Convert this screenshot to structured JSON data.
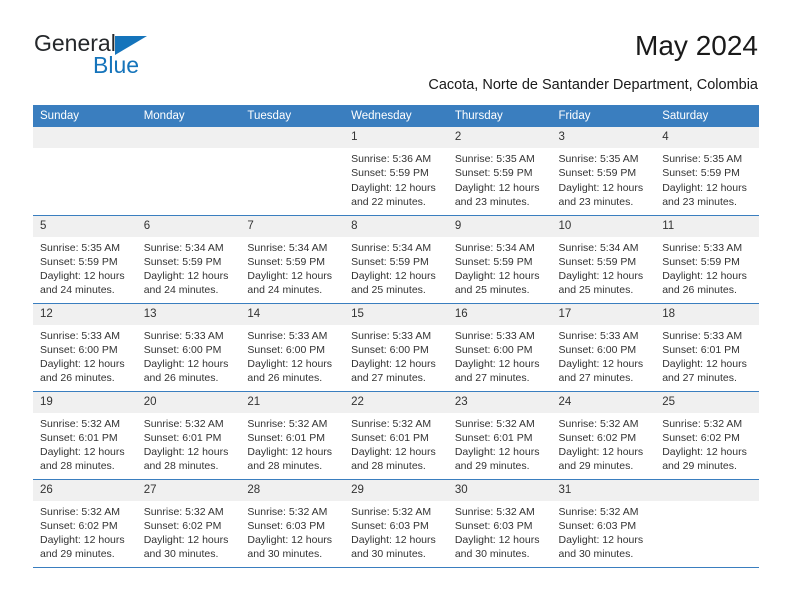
{
  "brand": {
    "name_part1": "General",
    "name_part2": "Blue",
    "logo_icon": "triangle-logo-icon",
    "accent_color": "#1574bb"
  },
  "header": {
    "title": "May 2024",
    "subtitle": "Cacota, Norte de Santander Department, Colombia"
  },
  "theme": {
    "header_row_color": "#3a7ebf",
    "day_number_band_color": "#f0f0f0",
    "text_color": "#333333"
  },
  "weekday_headers": [
    "Sunday",
    "Monday",
    "Tuesday",
    "Wednesday",
    "Thursday",
    "Friday",
    "Saturday"
  ],
  "weeks": [
    [
      {
        "day": "",
        "empty": true,
        "sunrise": "",
        "sunset": "",
        "daylight_line1": "",
        "daylight_line2": ""
      },
      {
        "day": "",
        "empty": true,
        "sunrise": "",
        "sunset": "",
        "daylight_line1": "",
        "daylight_line2": ""
      },
      {
        "day": "",
        "empty": true,
        "sunrise": "",
        "sunset": "",
        "daylight_line1": "",
        "daylight_line2": ""
      },
      {
        "day": "1",
        "empty": false,
        "sunrise": "Sunrise: 5:36 AM",
        "sunset": "Sunset: 5:59 PM",
        "daylight_line1": "Daylight: 12 hours",
        "daylight_line2": "and 22 minutes."
      },
      {
        "day": "2",
        "empty": false,
        "sunrise": "Sunrise: 5:35 AM",
        "sunset": "Sunset: 5:59 PM",
        "daylight_line1": "Daylight: 12 hours",
        "daylight_line2": "and 23 minutes."
      },
      {
        "day": "3",
        "empty": false,
        "sunrise": "Sunrise: 5:35 AM",
        "sunset": "Sunset: 5:59 PM",
        "daylight_line1": "Daylight: 12 hours",
        "daylight_line2": "and 23 minutes."
      },
      {
        "day": "4",
        "empty": false,
        "sunrise": "Sunrise: 5:35 AM",
        "sunset": "Sunset: 5:59 PM",
        "daylight_line1": "Daylight: 12 hours",
        "daylight_line2": "and 23 minutes."
      }
    ],
    [
      {
        "day": "5",
        "empty": false,
        "sunrise": "Sunrise: 5:35 AM",
        "sunset": "Sunset: 5:59 PM",
        "daylight_line1": "Daylight: 12 hours",
        "daylight_line2": "and 24 minutes."
      },
      {
        "day": "6",
        "empty": false,
        "sunrise": "Sunrise: 5:34 AM",
        "sunset": "Sunset: 5:59 PM",
        "daylight_line1": "Daylight: 12 hours",
        "daylight_line2": "and 24 minutes."
      },
      {
        "day": "7",
        "empty": false,
        "sunrise": "Sunrise: 5:34 AM",
        "sunset": "Sunset: 5:59 PM",
        "daylight_line1": "Daylight: 12 hours",
        "daylight_line2": "and 24 minutes."
      },
      {
        "day": "8",
        "empty": false,
        "sunrise": "Sunrise: 5:34 AM",
        "sunset": "Sunset: 5:59 PM",
        "daylight_line1": "Daylight: 12 hours",
        "daylight_line2": "and 25 minutes."
      },
      {
        "day": "9",
        "empty": false,
        "sunrise": "Sunrise: 5:34 AM",
        "sunset": "Sunset: 5:59 PM",
        "daylight_line1": "Daylight: 12 hours",
        "daylight_line2": "and 25 minutes."
      },
      {
        "day": "10",
        "empty": false,
        "sunrise": "Sunrise: 5:34 AM",
        "sunset": "Sunset: 5:59 PM",
        "daylight_line1": "Daylight: 12 hours",
        "daylight_line2": "and 25 minutes."
      },
      {
        "day": "11",
        "empty": false,
        "sunrise": "Sunrise: 5:33 AM",
        "sunset": "Sunset: 5:59 PM",
        "daylight_line1": "Daylight: 12 hours",
        "daylight_line2": "and 26 minutes."
      }
    ],
    [
      {
        "day": "12",
        "empty": false,
        "sunrise": "Sunrise: 5:33 AM",
        "sunset": "Sunset: 6:00 PM",
        "daylight_line1": "Daylight: 12 hours",
        "daylight_line2": "and 26 minutes."
      },
      {
        "day": "13",
        "empty": false,
        "sunrise": "Sunrise: 5:33 AM",
        "sunset": "Sunset: 6:00 PM",
        "daylight_line1": "Daylight: 12 hours",
        "daylight_line2": "and 26 minutes."
      },
      {
        "day": "14",
        "empty": false,
        "sunrise": "Sunrise: 5:33 AM",
        "sunset": "Sunset: 6:00 PM",
        "daylight_line1": "Daylight: 12 hours",
        "daylight_line2": "and 26 minutes."
      },
      {
        "day": "15",
        "empty": false,
        "sunrise": "Sunrise: 5:33 AM",
        "sunset": "Sunset: 6:00 PM",
        "daylight_line1": "Daylight: 12 hours",
        "daylight_line2": "and 27 minutes."
      },
      {
        "day": "16",
        "empty": false,
        "sunrise": "Sunrise: 5:33 AM",
        "sunset": "Sunset: 6:00 PM",
        "daylight_line1": "Daylight: 12 hours",
        "daylight_line2": "and 27 minutes."
      },
      {
        "day": "17",
        "empty": false,
        "sunrise": "Sunrise: 5:33 AM",
        "sunset": "Sunset: 6:00 PM",
        "daylight_line1": "Daylight: 12 hours",
        "daylight_line2": "and 27 minutes."
      },
      {
        "day": "18",
        "empty": false,
        "sunrise": "Sunrise: 5:33 AM",
        "sunset": "Sunset: 6:01 PM",
        "daylight_line1": "Daylight: 12 hours",
        "daylight_line2": "and 27 minutes."
      }
    ],
    [
      {
        "day": "19",
        "empty": false,
        "sunrise": "Sunrise: 5:32 AM",
        "sunset": "Sunset: 6:01 PM",
        "daylight_line1": "Daylight: 12 hours",
        "daylight_line2": "and 28 minutes."
      },
      {
        "day": "20",
        "empty": false,
        "sunrise": "Sunrise: 5:32 AM",
        "sunset": "Sunset: 6:01 PM",
        "daylight_line1": "Daylight: 12 hours",
        "daylight_line2": "and 28 minutes."
      },
      {
        "day": "21",
        "empty": false,
        "sunrise": "Sunrise: 5:32 AM",
        "sunset": "Sunset: 6:01 PM",
        "daylight_line1": "Daylight: 12 hours",
        "daylight_line2": "and 28 minutes."
      },
      {
        "day": "22",
        "empty": false,
        "sunrise": "Sunrise: 5:32 AM",
        "sunset": "Sunset: 6:01 PM",
        "daylight_line1": "Daylight: 12 hours",
        "daylight_line2": "and 28 minutes."
      },
      {
        "day": "23",
        "empty": false,
        "sunrise": "Sunrise: 5:32 AM",
        "sunset": "Sunset: 6:01 PM",
        "daylight_line1": "Daylight: 12 hours",
        "daylight_line2": "and 29 minutes."
      },
      {
        "day": "24",
        "empty": false,
        "sunrise": "Sunrise: 5:32 AM",
        "sunset": "Sunset: 6:02 PM",
        "daylight_line1": "Daylight: 12 hours",
        "daylight_line2": "and 29 minutes."
      },
      {
        "day": "25",
        "empty": false,
        "sunrise": "Sunrise: 5:32 AM",
        "sunset": "Sunset: 6:02 PM",
        "daylight_line1": "Daylight: 12 hours",
        "daylight_line2": "and 29 minutes."
      }
    ],
    [
      {
        "day": "26",
        "empty": false,
        "sunrise": "Sunrise: 5:32 AM",
        "sunset": "Sunset: 6:02 PM",
        "daylight_line1": "Daylight: 12 hours",
        "daylight_line2": "and 29 minutes."
      },
      {
        "day": "27",
        "empty": false,
        "sunrise": "Sunrise: 5:32 AM",
        "sunset": "Sunset: 6:02 PM",
        "daylight_line1": "Daylight: 12 hours",
        "daylight_line2": "and 30 minutes."
      },
      {
        "day": "28",
        "empty": false,
        "sunrise": "Sunrise: 5:32 AM",
        "sunset": "Sunset: 6:03 PM",
        "daylight_line1": "Daylight: 12 hours",
        "daylight_line2": "and 30 minutes."
      },
      {
        "day": "29",
        "empty": false,
        "sunrise": "Sunrise: 5:32 AM",
        "sunset": "Sunset: 6:03 PM",
        "daylight_line1": "Daylight: 12 hours",
        "daylight_line2": "and 30 minutes."
      },
      {
        "day": "30",
        "empty": false,
        "sunrise": "Sunrise: 5:32 AM",
        "sunset": "Sunset: 6:03 PM",
        "daylight_line1": "Daylight: 12 hours",
        "daylight_line2": "and 30 minutes."
      },
      {
        "day": "31",
        "empty": false,
        "sunrise": "Sunrise: 5:32 AM",
        "sunset": "Sunset: 6:03 PM",
        "daylight_line1": "Daylight: 12 hours",
        "daylight_line2": "and 30 minutes."
      },
      {
        "day": "",
        "empty": true,
        "sunrise": "",
        "sunset": "",
        "daylight_line1": "",
        "daylight_line2": ""
      }
    ]
  ]
}
